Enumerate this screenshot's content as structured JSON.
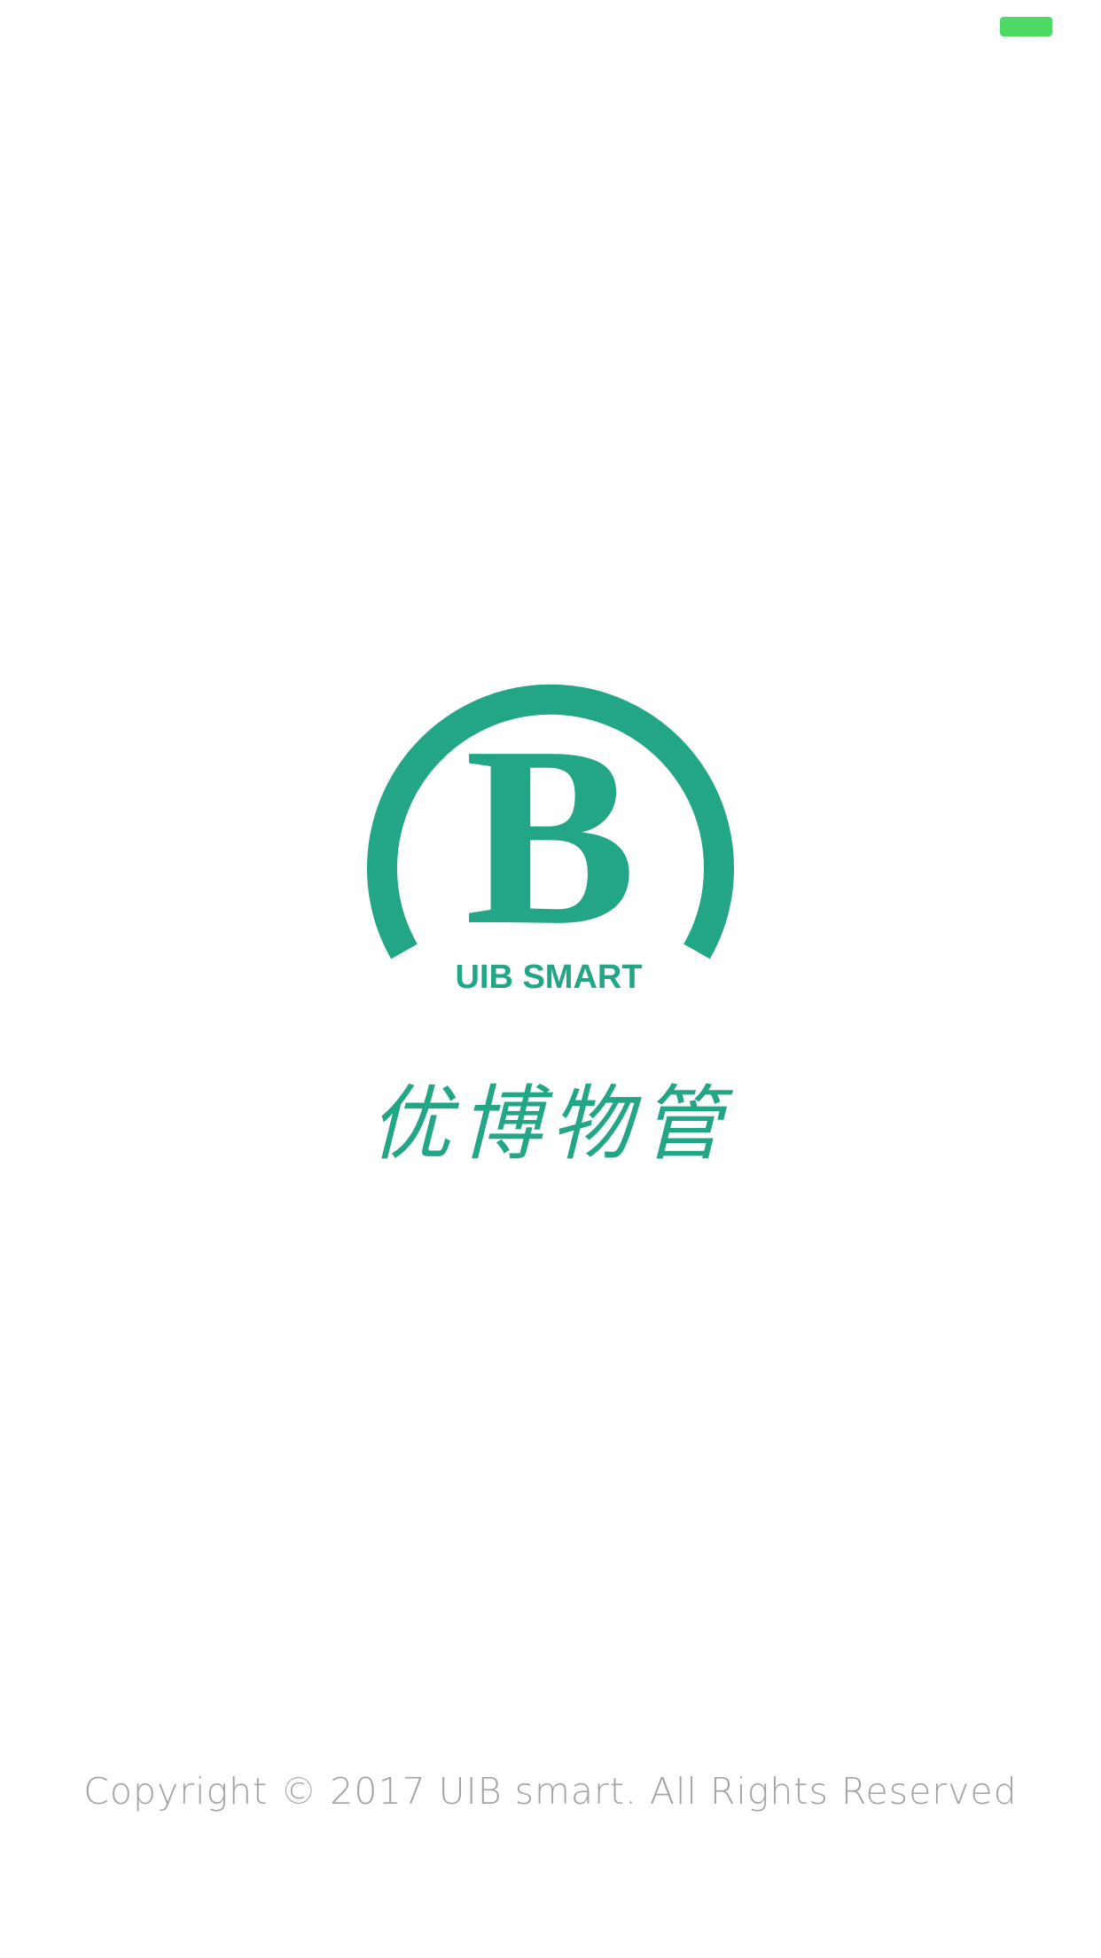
{
  "logo": {
    "letter": "B",
    "wordmark": "UIB SMART",
    "color": "#22a685"
  },
  "app": {
    "name": "优博物管"
  },
  "footer": {
    "copyright": "Copyright © 2017 UIB smart. All Rights Reserved"
  },
  "status_bar": {
    "battery_color": "#4cd964",
    "battery_icon": "battery-icon"
  }
}
